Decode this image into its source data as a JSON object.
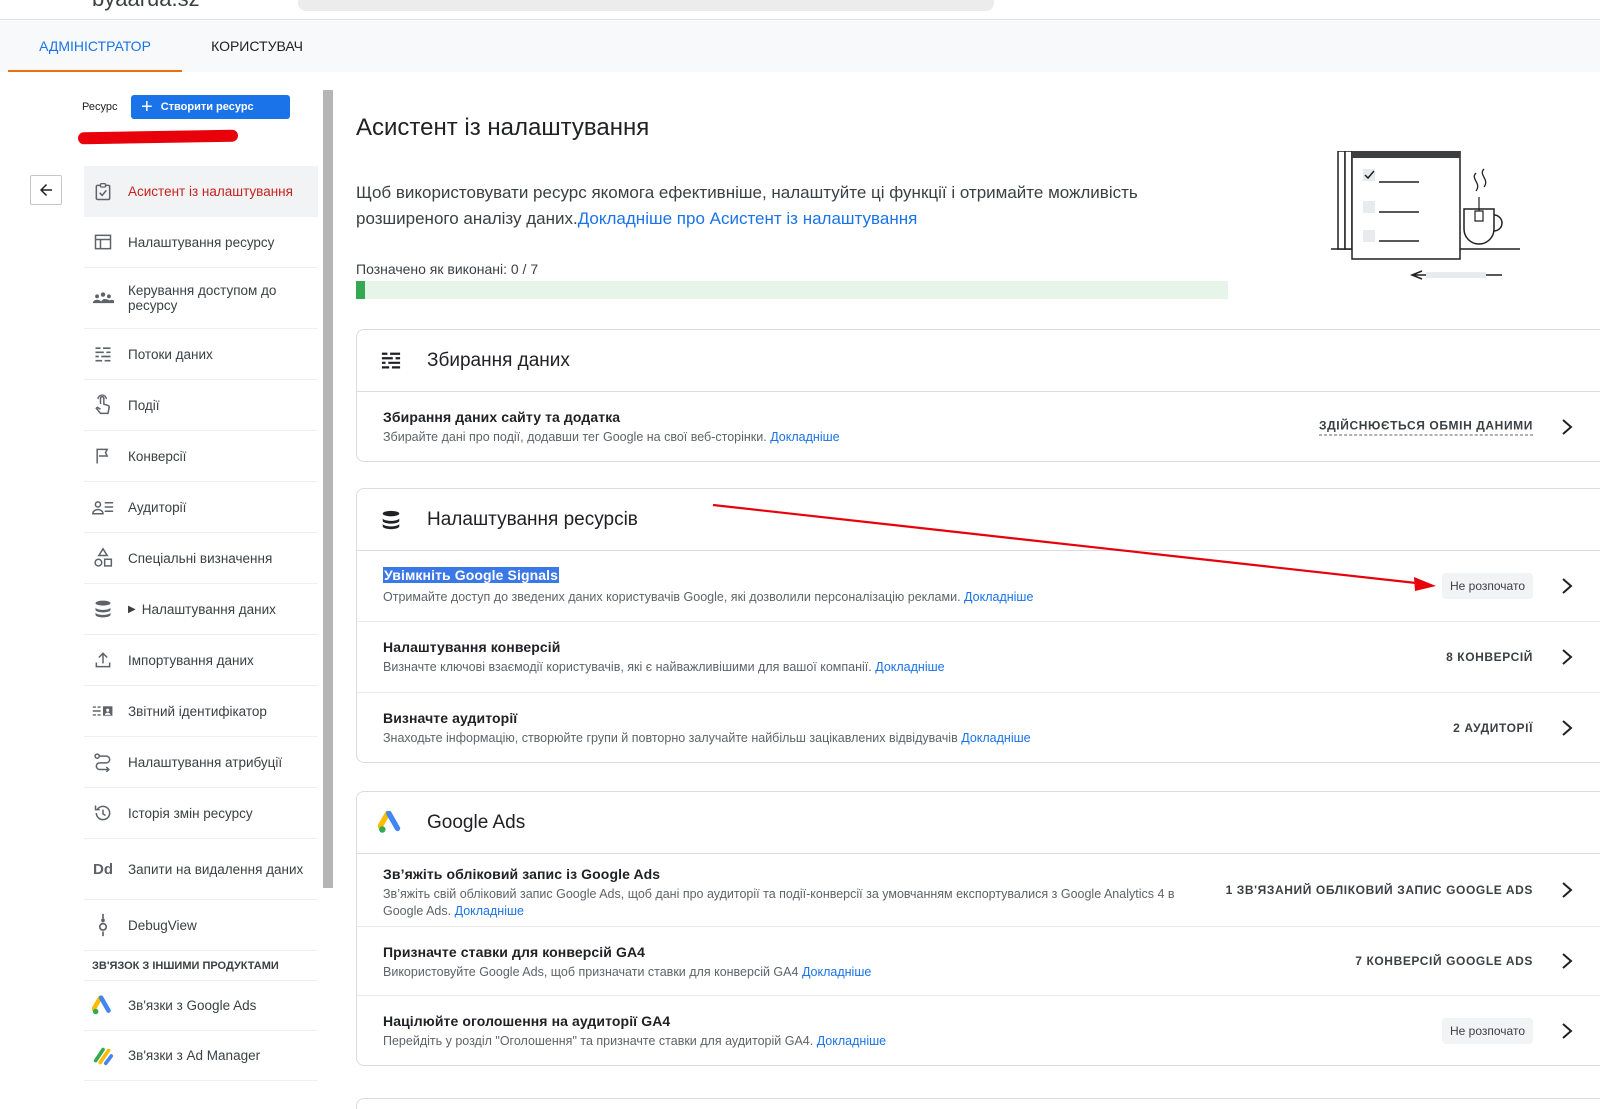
{
  "topbar": {
    "account": "byaarua.sz"
  },
  "tabs": [
    {
      "label": "АДМІНІСТРАТОР"
    },
    {
      "label": "КОРИСТУВАЧ"
    }
  ],
  "sidebar": {
    "resource_label": "Ресурс",
    "create_button": "Створити ресурс",
    "items": [
      {
        "label": "Асистент із налаштування",
        "icon": "checklist-icon"
      },
      {
        "label": "Налаштування ресурсу",
        "icon": "window-icon"
      },
      {
        "label": "Керування доступом до ресурсу",
        "icon": "people-icon"
      },
      {
        "label": "Потоки даних",
        "icon": "streams-icon"
      },
      {
        "label": "Події",
        "icon": "touch-icon"
      },
      {
        "label": "Конверсії",
        "icon": "flag-icon"
      },
      {
        "label": "Аудиторії",
        "icon": "audience-icon"
      },
      {
        "label": "Спеціальні визначення",
        "icon": "shapes-icon"
      },
      {
        "label": "Налаштування даних",
        "icon": "database-icon"
      },
      {
        "label": "Імпортування даних",
        "icon": "upload-icon"
      },
      {
        "label": "Звітний ідентифікатор",
        "icon": "id-icon"
      },
      {
        "label": "Налаштування атрибуції",
        "icon": "attribution-icon"
      },
      {
        "label": "Історія змін ресурсу",
        "icon": "history-icon"
      },
      {
        "label": "Запити на видалення даних",
        "icon": "delete-data-icon"
      },
      {
        "label": "DebugView",
        "icon": "debug-icon"
      }
    ],
    "section_links": "ЗВ'ЯЗОК З ІНШИМИ ПРОДУКТАМИ",
    "links": [
      {
        "label": "Зв'язки з Google Ads",
        "icon": "google-ads-icon"
      },
      {
        "label": "Зв'язки з Ad Manager",
        "icon": "ad-manager-icon"
      }
    ]
  },
  "main": {
    "title": "Асистент із налаштування",
    "intro": "Щоб використовувати ресурс якомога ефективніше, налаштуйте ці функції і отримайте можливість розширеного аналізу даних.",
    "intro_link": "Докладніше про Асистент із налаштування",
    "progress_label": "Позначено як виконані: 0 / 7",
    "progress_done": 0,
    "progress_total": 7
  },
  "cards": [
    {
      "title": "Збирання даних",
      "rows": [
        {
          "title": "Збирання даних сайту та додатка",
          "desc": "Збирайте дані про події, додавши тег Google на свої веб-сторінки.",
          "link": "Докладніше",
          "status": "ЗДІЙСНЮЄТЬСЯ ОБМІН ДАНИМИ"
        }
      ]
    },
    {
      "title": "Налаштування ресурсів",
      "rows": [
        {
          "title": "Увімкніть Google Signals",
          "desc": "Отримайте доступ до зведених даних користувачів Google, які дозволили персоналізацію реклами.",
          "link": "Докладніше",
          "status": "Не розпочато"
        },
        {
          "title": "Налаштування конверсій",
          "desc": "Визначте ключові взаємодії користувачів, які є найважливішими для вашої компанії.",
          "link": "Докладніше",
          "status": "8 КОНВЕРСІЙ"
        },
        {
          "title": "Визначте аудиторії",
          "desc": "Знаходьте інформацію, створюйте групи й повторно залучайте найбільш зацікавлених відвідувачів",
          "link": "Докладніше",
          "status": "2 АУДИТОРІЇ"
        }
      ]
    },
    {
      "title": "Google Ads",
      "rows": [
        {
          "title": "Зв’яжіть обліковий запис із Google Ads",
          "desc": "Зв’яжіть свій обліковий запис Google Ads, щоб дані про аудиторії та події-конверсії за умовчанням експортувалися з Google Analytics 4 в Google Ads.",
          "link": "Докладніше",
          "status": "1 ЗВ'ЯЗАНИЙ ОБЛІКОВИЙ ЗАПИС GOOGLE ADS"
        },
        {
          "title": "Призначте ставки для конверсій GA4",
          "desc": "Використовуйте Google Ads, щоб призначати ставки для конверсій GA4",
          "link": "Докладніше",
          "status": "7 КОНВЕРСІЙ GOOGLE ADS"
        },
        {
          "title": "Націлюйте оголошення на аудиторії GA4",
          "desc": "Перейдіть у розділ \"Оголошення\" та призначте ставки для аудиторій GA4.",
          "link": "Докладніше",
          "status": "Не розпочато"
        }
      ]
    }
  ],
  "colors": {
    "accent": "#1a73e8",
    "annotation": "#e8000b",
    "progress_bg": "#e6f4ea",
    "progress_fill": "#34a853"
  }
}
